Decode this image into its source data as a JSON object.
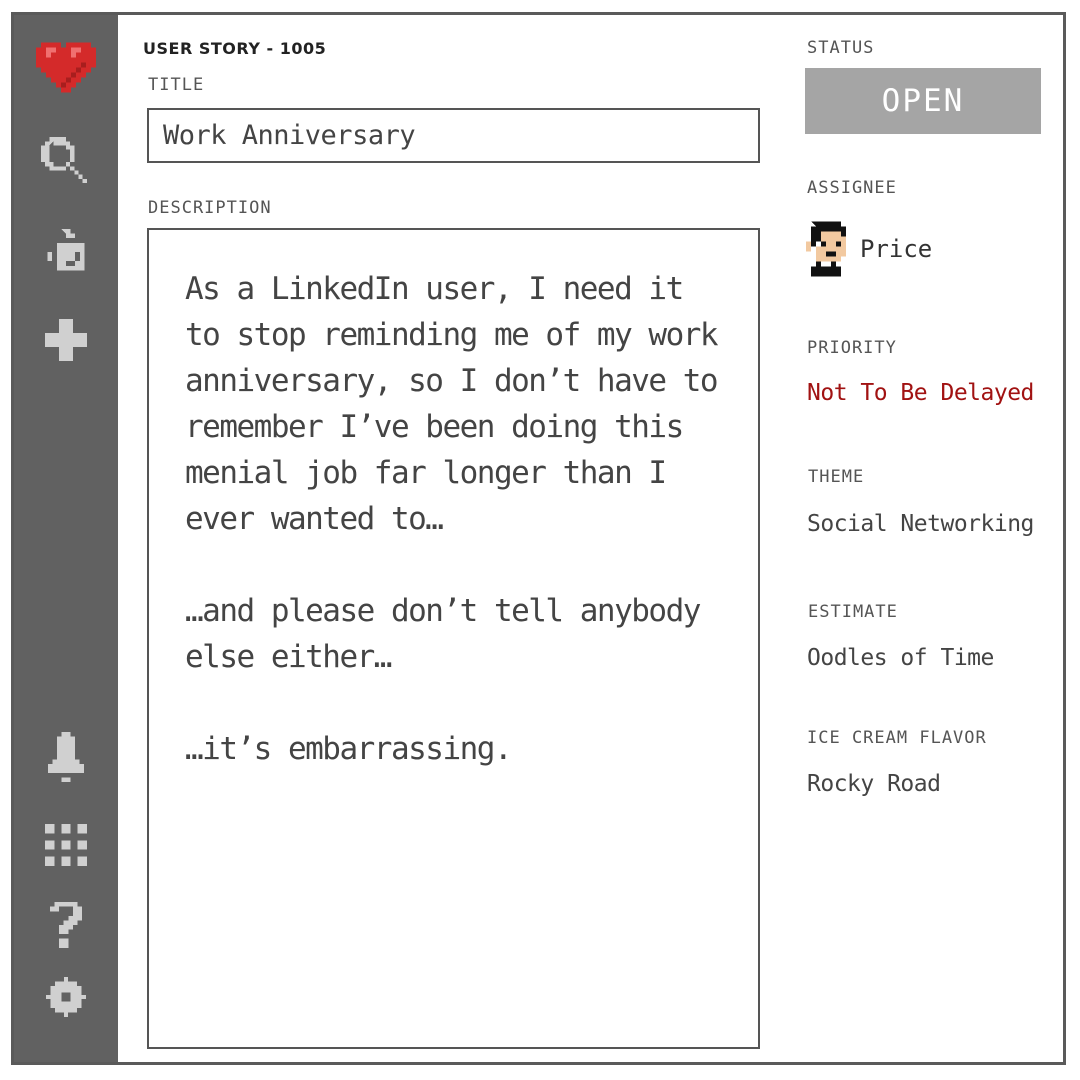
{
  "story": {
    "id_label": "USER STORY - 1005",
    "title_label": "TITLE",
    "title_value": "Work Anniversary",
    "description_label": "DESCRIPTION",
    "description": [
      "As a LinkedIn user, I need it to stop reminding me of my work anniversary, so I don’t have to remember I’ve been doing this menial job far longer than I ever wanted to…",
      "…and please don’t tell anybody else either…",
      "…it’s embarrassing."
    ]
  },
  "details": {
    "status_label": "STATUS",
    "status_value": "OPEN",
    "assignee_label": "ASSIGNEE",
    "assignee_name": "Price",
    "priority_label": "PRIORITY",
    "priority_value": "Not To Be Delayed",
    "theme_label": "THEME",
    "theme_value": "Social Networking",
    "estimate_label": "ESTIMATE",
    "estimate_value": "Oodles of Time",
    "flavor_label": "ICE CREAM FLAVOR",
    "flavor_value": "Rocky Road"
  },
  "sidebar": {
    "icons": [
      "heart-logo-icon",
      "search-icon",
      "puzzle-icon",
      "plus-icon",
      "bell-icon",
      "grid-icon",
      "help-icon",
      "gear-icon"
    ]
  },
  "colors": {
    "sidebar": "#616161",
    "status_bg": "#a5a5a5",
    "priority": "#a11212",
    "heart": "#d42a2a"
  }
}
